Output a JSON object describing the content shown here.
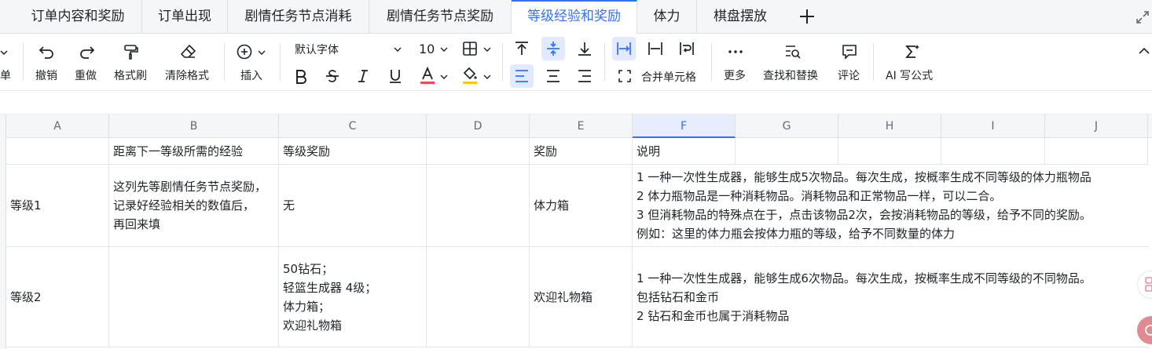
{
  "tabs": [
    {
      "label": "订单内容和奖励"
    },
    {
      "label": "订单出现"
    },
    {
      "label": "剧情任务节点消耗"
    },
    {
      "label": "剧情任务节点奖励"
    },
    {
      "label": "等级经验和奖励",
      "active": true
    },
    {
      "label": "体力"
    },
    {
      "label": "棋盘摆放"
    }
  ],
  "toolbar": {
    "cut_label": "单",
    "undo": "撤销",
    "redo": "重做",
    "format_painter": "格式刷",
    "clear_format": "清除格式",
    "insert": "插入",
    "font_name": "默认字体",
    "font_size": "10",
    "merge_cells": "合并单元格",
    "more": "更多",
    "find_replace": "查找和替换",
    "comment": "评论",
    "ai_formula": "AI 写公式"
  },
  "colors": {
    "accent": "#3370ff",
    "font_color_bar": "#f54a45",
    "fill_color_bar": "#ffc60a"
  },
  "columns": [
    "A",
    "B",
    "C",
    "D",
    "E",
    "F",
    "G",
    "H",
    "I",
    "J"
  ],
  "selected_column": "F",
  "rows": [
    {
      "A": "",
      "B": "距离下一等级所需的经验",
      "C": "等级奖励",
      "D": "",
      "E": "奖励",
      "F": "说明"
    },
    {
      "A": "等级1",
      "B": "这列先等剧情任务节点奖励，\n记录好经验相关的数值后，\n再回来填",
      "C": "无",
      "D": "",
      "E": "体力箱",
      "F": "1 一种一次性生成器，能够生成5次物品。每次生成，按概率生成不同等级的体力瓶物品\n2 体力瓶物品是一种消耗物品。消耗物品和正常物品一样，可以二合。\n3 但消耗物品的特殊点在于，点击该物品2次，会按消耗物品的等级，给予不同的奖励。\n例如：这里的体力瓶会按体力瓶的等级，给予不同数量的体力"
    },
    {
      "A": "等级2",
      "B": "",
      "C": "50钻石；\n轻篮生成器 4级；\n体力箱；\n欢迎礼物箱",
      "D": "",
      "E": "欢迎礼物箱",
      "F": "1 一种一次性生成器，能够生成6次物品。每次生成，按概率生成不同等级的不同物品。\n包括钻石和金币\n2 钻石和金币也属于消耗物品"
    }
  ]
}
